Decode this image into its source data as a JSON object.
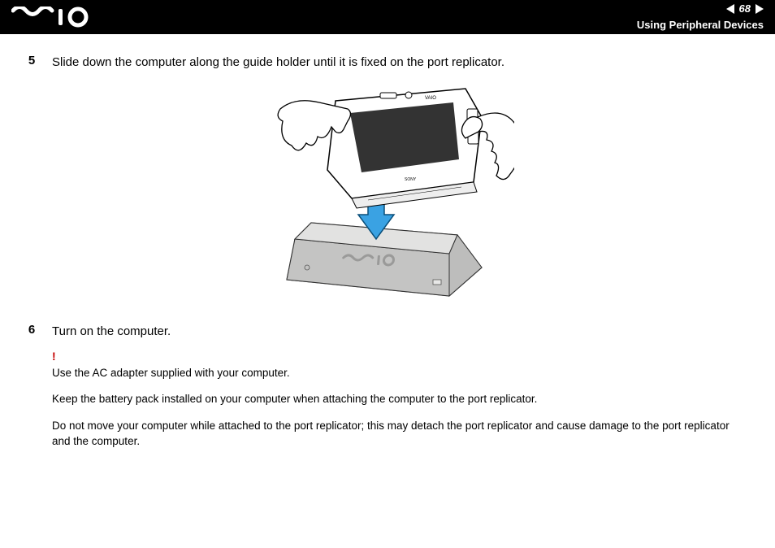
{
  "header": {
    "page_number": "68",
    "section_title": "Using Peripheral Devices"
  },
  "steps": [
    {
      "num": "5",
      "text": "Slide down the computer along the guide holder until it is fixed on the port replicator."
    },
    {
      "num": "6",
      "text": "Turn on the computer."
    }
  ],
  "notes": {
    "bang": "!",
    "p1": "Use the AC adapter supplied with your computer.",
    "p2": "Keep the battery pack installed on your computer when attaching the computer to the port replicator.",
    "p3": "Do not move your computer while attached to the port replicator; this may detach the port replicator and cause damage to the port replicator and the computer."
  }
}
